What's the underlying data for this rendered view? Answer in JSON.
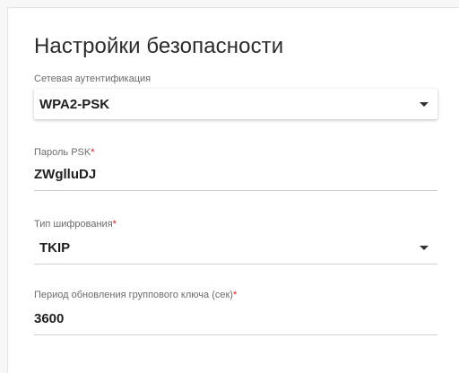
{
  "section": {
    "title": "Настройки безопасности"
  },
  "fields": {
    "auth": {
      "label": "Сетевая аутентификация",
      "value": "WPA2-PSK",
      "icon": "chevron-down-icon"
    },
    "psk": {
      "label": "Пароль PSK",
      "required_mark": "*",
      "value": "ZWglluDJ"
    },
    "encryption": {
      "label": "Тип шифрования",
      "required_mark": "*",
      "value": "TKIP",
      "icon": "chevron-down-icon"
    },
    "group_key": {
      "label": "Период обновления группового ключа (сек)",
      "required_mark": "*",
      "value": "3600"
    }
  },
  "colors": {
    "required": "#d11a1a",
    "label": "#6b6b6b",
    "text": "#1f1f1f"
  }
}
